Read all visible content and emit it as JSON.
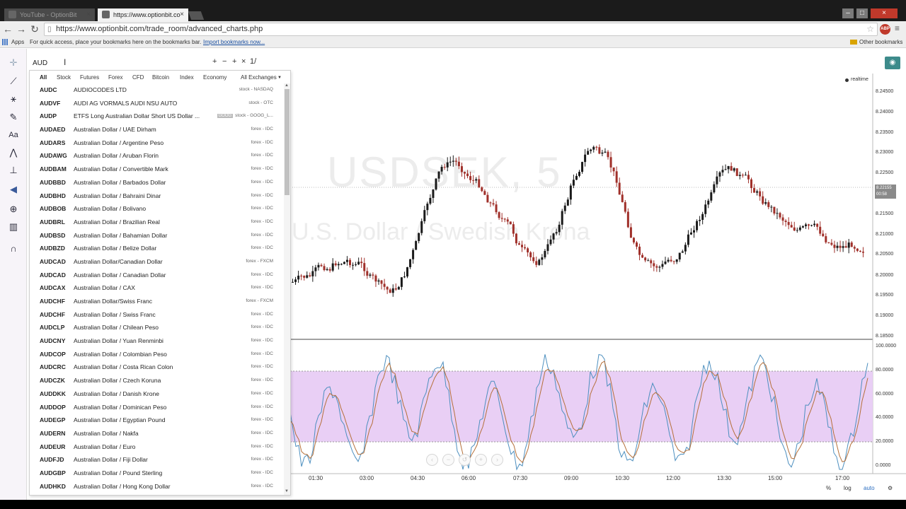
{
  "browser": {
    "tabs": [
      {
        "label": "YouTube - OptionBit"
      },
      {
        "label": "https://www.optionbit.co"
      }
    ],
    "url": "https://www.optionbit.com/trade_room/advanced_charts.php",
    "ext_label": "ABP",
    "bookmarks": {
      "apps": "Apps",
      "hint": "For quick access, place your bookmarks here on the bookmarks bar.",
      "import": "Import bookmarks now...",
      "other": "Other bookmarks"
    }
  },
  "search": {
    "value": "AUD",
    "ops": [
      "+",
      "−",
      "+",
      "×",
      "1/"
    ],
    "filters": [
      "All",
      "Stock",
      "Futures",
      "Forex",
      "CFD",
      "Bitcoin",
      "Index",
      "Economy",
      "All Exchanges"
    ],
    "results": [
      {
        "sym": "AUDC",
        "desc": "AUDIOCODES LTD",
        "exch": "stock - NASDAQ"
      },
      {
        "sym": "AUDVF",
        "desc": "AUDI AG VORMALS AUDI NSU AUTO",
        "exch": "stock - OTC"
      },
      {
        "sym": "AUDP",
        "desc": "ETFS Long Australian Dollar Short US Dollar ...",
        "badge": "GOOG",
        "exch": "stock - GOOG_L..."
      },
      {
        "sym": "AUDAED",
        "desc": "Australian Dollar / UAE Dirham",
        "exch": "forex - IDC"
      },
      {
        "sym": "AUDARS",
        "desc": "Australian Dollar / Argentine Peso",
        "exch": "forex - IDC"
      },
      {
        "sym": "AUDAWG",
        "desc": "Australian Dollar / Aruban Florin",
        "exch": "forex - IDC"
      },
      {
        "sym": "AUDBAM",
        "desc": "Australian Dollar / Convertible Mark",
        "exch": "forex - IDC"
      },
      {
        "sym": "AUDBBD",
        "desc": "Australian Dollar / Barbados Dollar",
        "exch": "forex - IDC"
      },
      {
        "sym": "AUDBHD",
        "desc": "Australian Dollar / Bahraini Dinar",
        "exch": "forex - IDC"
      },
      {
        "sym": "AUDBOB",
        "desc": "Australian Dollar / Bolivano",
        "exch": "forex - IDC"
      },
      {
        "sym": "AUDBRL",
        "desc": "Australian Dollar / Brazilian Real",
        "exch": "forex - IDC"
      },
      {
        "sym": "AUDBSD",
        "desc": "Australian Dollar / Bahamian Dollar",
        "exch": "forex - IDC"
      },
      {
        "sym": "AUDBZD",
        "desc": "Australian Dollar / Belize Dollar",
        "exch": "forex - IDC"
      },
      {
        "sym": "AUDCAD",
        "desc": "Australian Dollar/Canadian Dollar",
        "exch": "forex - FXCM"
      },
      {
        "sym": "AUDCAD",
        "desc": "Australian Dollar / Canadian Dollar",
        "exch": "forex - IDC"
      },
      {
        "sym": "AUDCAX",
        "desc": "Australian Dollar / CAX",
        "exch": "forex - IDC"
      },
      {
        "sym": "AUDCHF",
        "desc": "Australian Dollar/Swiss Franc",
        "exch": "forex - FXCM"
      },
      {
        "sym": "AUDCHF",
        "desc": "Australian Dollar / Swiss Franc",
        "exch": "forex - IDC"
      },
      {
        "sym": "AUDCLP",
        "desc": "Australian Dollar / Chilean Peso",
        "exch": "forex - IDC"
      },
      {
        "sym": "AUDCNY",
        "desc": "Australian Dollar / Yuan Renminbi",
        "exch": "forex - IDC"
      },
      {
        "sym": "AUDCOP",
        "desc": "Australian Dollar / Colombian Peso",
        "exch": "forex - IDC"
      },
      {
        "sym": "AUDCRC",
        "desc": "Australian Dollar / Costa Rican Colon",
        "exch": "forex - IDC"
      },
      {
        "sym": "AUDCZK",
        "desc": "Australian Dollar / Czech Koruna",
        "exch": "forex - IDC"
      },
      {
        "sym": "AUDDKK",
        "desc": "Australian Dollar / Danish Krone",
        "exch": "forex - IDC"
      },
      {
        "sym": "AUDDOP",
        "desc": "Australian Dollar / Dominican Peso",
        "exch": "forex - IDC"
      },
      {
        "sym": "AUDEGP",
        "desc": "Australian Dollar / Egyptian Pound",
        "exch": "forex - IDC"
      },
      {
        "sym": "AUDERN",
        "desc": "Australian Dollar / Nakfa",
        "exch": "forex - IDC"
      },
      {
        "sym": "AUDEUR",
        "desc": "Australian Dollar / Euro",
        "exch": "forex - IDC"
      },
      {
        "sym": "AUDFJD",
        "desc": "Australian Dollar / Fiji Dollar",
        "exch": "forex - IDC"
      },
      {
        "sym": "AUDGBP",
        "desc": "Australian Dollar / Pound Sterling",
        "exch": "forex - IDC"
      },
      {
        "sym": "AUDHKD",
        "desc": "Australian Dollar / Hong Kong Dollar",
        "exch": "forex - IDC"
      }
    ]
  },
  "chart": {
    "watermark_symbol": "USDSEK, 5",
    "watermark_name": "U.S. Dollar / Swedish Krona",
    "realtime": "realtime",
    "price_tag": [
      "8.22155",
      "00:58"
    ],
    "y_labels": [
      "8.24500",
      "8.24000",
      "8.23500",
      "8.23000",
      "8.22500",
      "8.21500",
      "8.21000",
      "8.20500",
      "8.20000",
      "8.19500",
      "8.19000",
      "8.18500"
    ],
    "osc_labels": [
      "100.0000",
      "80.0000",
      "60.0000",
      "40.0000",
      "20.0000",
      "0.0000"
    ],
    "x_labels": [
      "01:30",
      "03:00",
      "04:30",
      "06:00",
      "07:30",
      "09:00",
      "10:30",
      "12:00",
      "13:30",
      "15:00",
      "17:00"
    ],
    "bottom_controls": [
      "%",
      "log",
      "auto"
    ],
    "colors": {
      "up": "#1a1a1a",
      "down": "#a0302a",
      "osc_band": "#e9cff5",
      "k_line": "#4d8fbf",
      "d_line": "#b5703a"
    }
  }
}
